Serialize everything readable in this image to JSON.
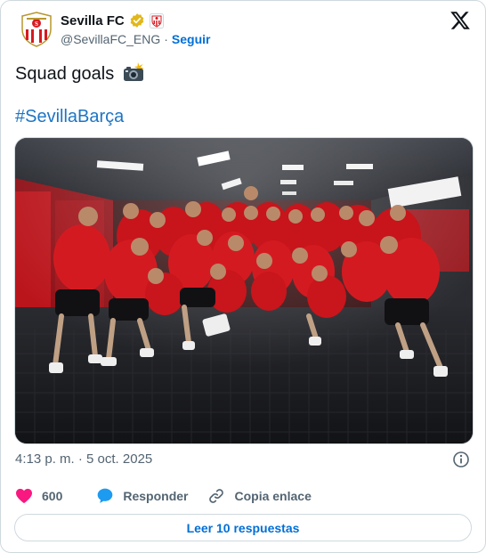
{
  "account": {
    "name": "Sevilla FC",
    "handle": "@SevillaFC_ENG",
    "separator": "·",
    "follow_label": "Seguir"
  },
  "icons": {
    "avatar": "sevilla-crest",
    "verified": "gold-verified-badge",
    "affiliate": "affiliate-crest-badge",
    "platform": "x-logo",
    "emoji": "camera-with-flash",
    "info": "info-icon",
    "like": "heart-icon",
    "reply": "speech-bubble-icon",
    "copy_link": "link-icon"
  },
  "tweet": {
    "text": "Squad goals",
    "hashtag": "#SevillaBarça",
    "timestamp": "4:13 p. m. · 5 oct. 2025"
  },
  "actions": {
    "likes_count": "600",
    "reply_label": "Responder",
    "copy_link_label": "Copia enlace"
  },
  "replies_button": "Leer 10 respuestas",
  "colors": {
    "like": "#f91880",
    "reply": "#1d9bf0",
    "link_blue": "#006fd6",
    "verified_gold": "#e2b719",
    "sevilla_red": "#d71920"
  }
}
